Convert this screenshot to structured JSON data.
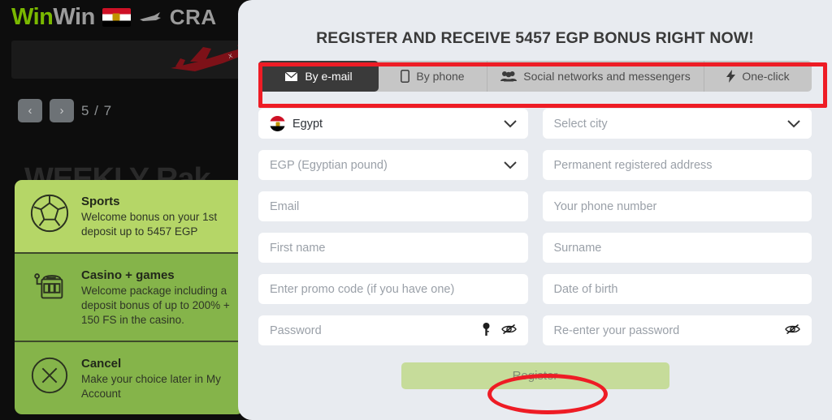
{
  "site": {
    "logo_win1": "Win",
    "logo_win2": "Win",
    "country_flag_icon": "egypt-flag-icon",
    "plane_icon": "plane-icon",
    "crash_label": "CRA",
    "banner_plane_icon": "crash-plane-graphic",
    "pager": {
      "prev_label": "‹",
      "next_label": "›",
      "count": "5 / 7"
    },
    "weekly_heading": "WEEKLY Rak"
  },
  "bonus_cards": [
    {
      "icon": "soccer-ball-icon",
      "title": "Sports",
      "desc": "Welcome bonus on your 1st deposit up to 5457 EGP"
    },
    {
      "icon": "slot-machine-icon",
      "title": "Casino + games",
      "desc": "Welcome package including a deposit bonus of up to 200% + 150 FS in the casino."
    },
    {
      "icon": "cancel-circle-icon",
      "title": "Cancel",
      "desc": "Make your choice later in My Account"
    }
  ],
  "modal": {
    "title": "REGISTER AND RECEIVE 5457 EGP BONUS RIGHT NOW!",
    "tabs": [
      {
        "label": "By e-mail",
        "icon": "envelope-icon",
        "active": true
      },
      {
        "label": "By phone",
        "icon": "mobile-phone-icon",
        "active": false
      },
      {
        "label": "Social networks and messengers",
        "icon": "people-group-icon",
        "active": false
      },
      {
        "label": "One-click",
        "icon": "lightning-bolt-icon",
        "active": false
      }
    ],
    "fields": {
      "country": {
        "value": "Egypt",
        "icon": "egypt-flag-circle-icon",
        "chevron": "chevron-down-icon"
      },
      "city": {
        "placeholder": "Select city",
        "chevron": "chevron-down-icon"
      },
      "currency": {
        "value": "EGP (Egyptian pound)",
        "chevron": "chevron-down-icon"
      },
      "address": {
        "placeholder": "Permanent registered address"
      },
      "email": {
        "placeholder": "Email"
      },
      "phone": {
        "placeholder": "Your phone number"
      },
      "first_name": {
        "placeholder": "First name"
      },
      "surname": {
        "placeholder": "Surname"
      },
      "promo": {
        "placeholder": "Enter promo code (if you have one)"
      },
      "dob": {
        "placeholder": "Date of birth"
      },
      "password": {
        "placeholder": "Password",
        "key_icon": "key-icon",
        "eye_icon": "eye-slash-icon"
      },
      "password_repeat": {
        "placeholder": "Re-enter your password",
        "eye_icon": "eye-slash-icon"
      }
    },
    "register_label": "Register"
  },
  "annotations": {
    "tabs_highlight_color": "#ee1c25",
    "register_highlight_color": "#ee1c25"
  }
}
